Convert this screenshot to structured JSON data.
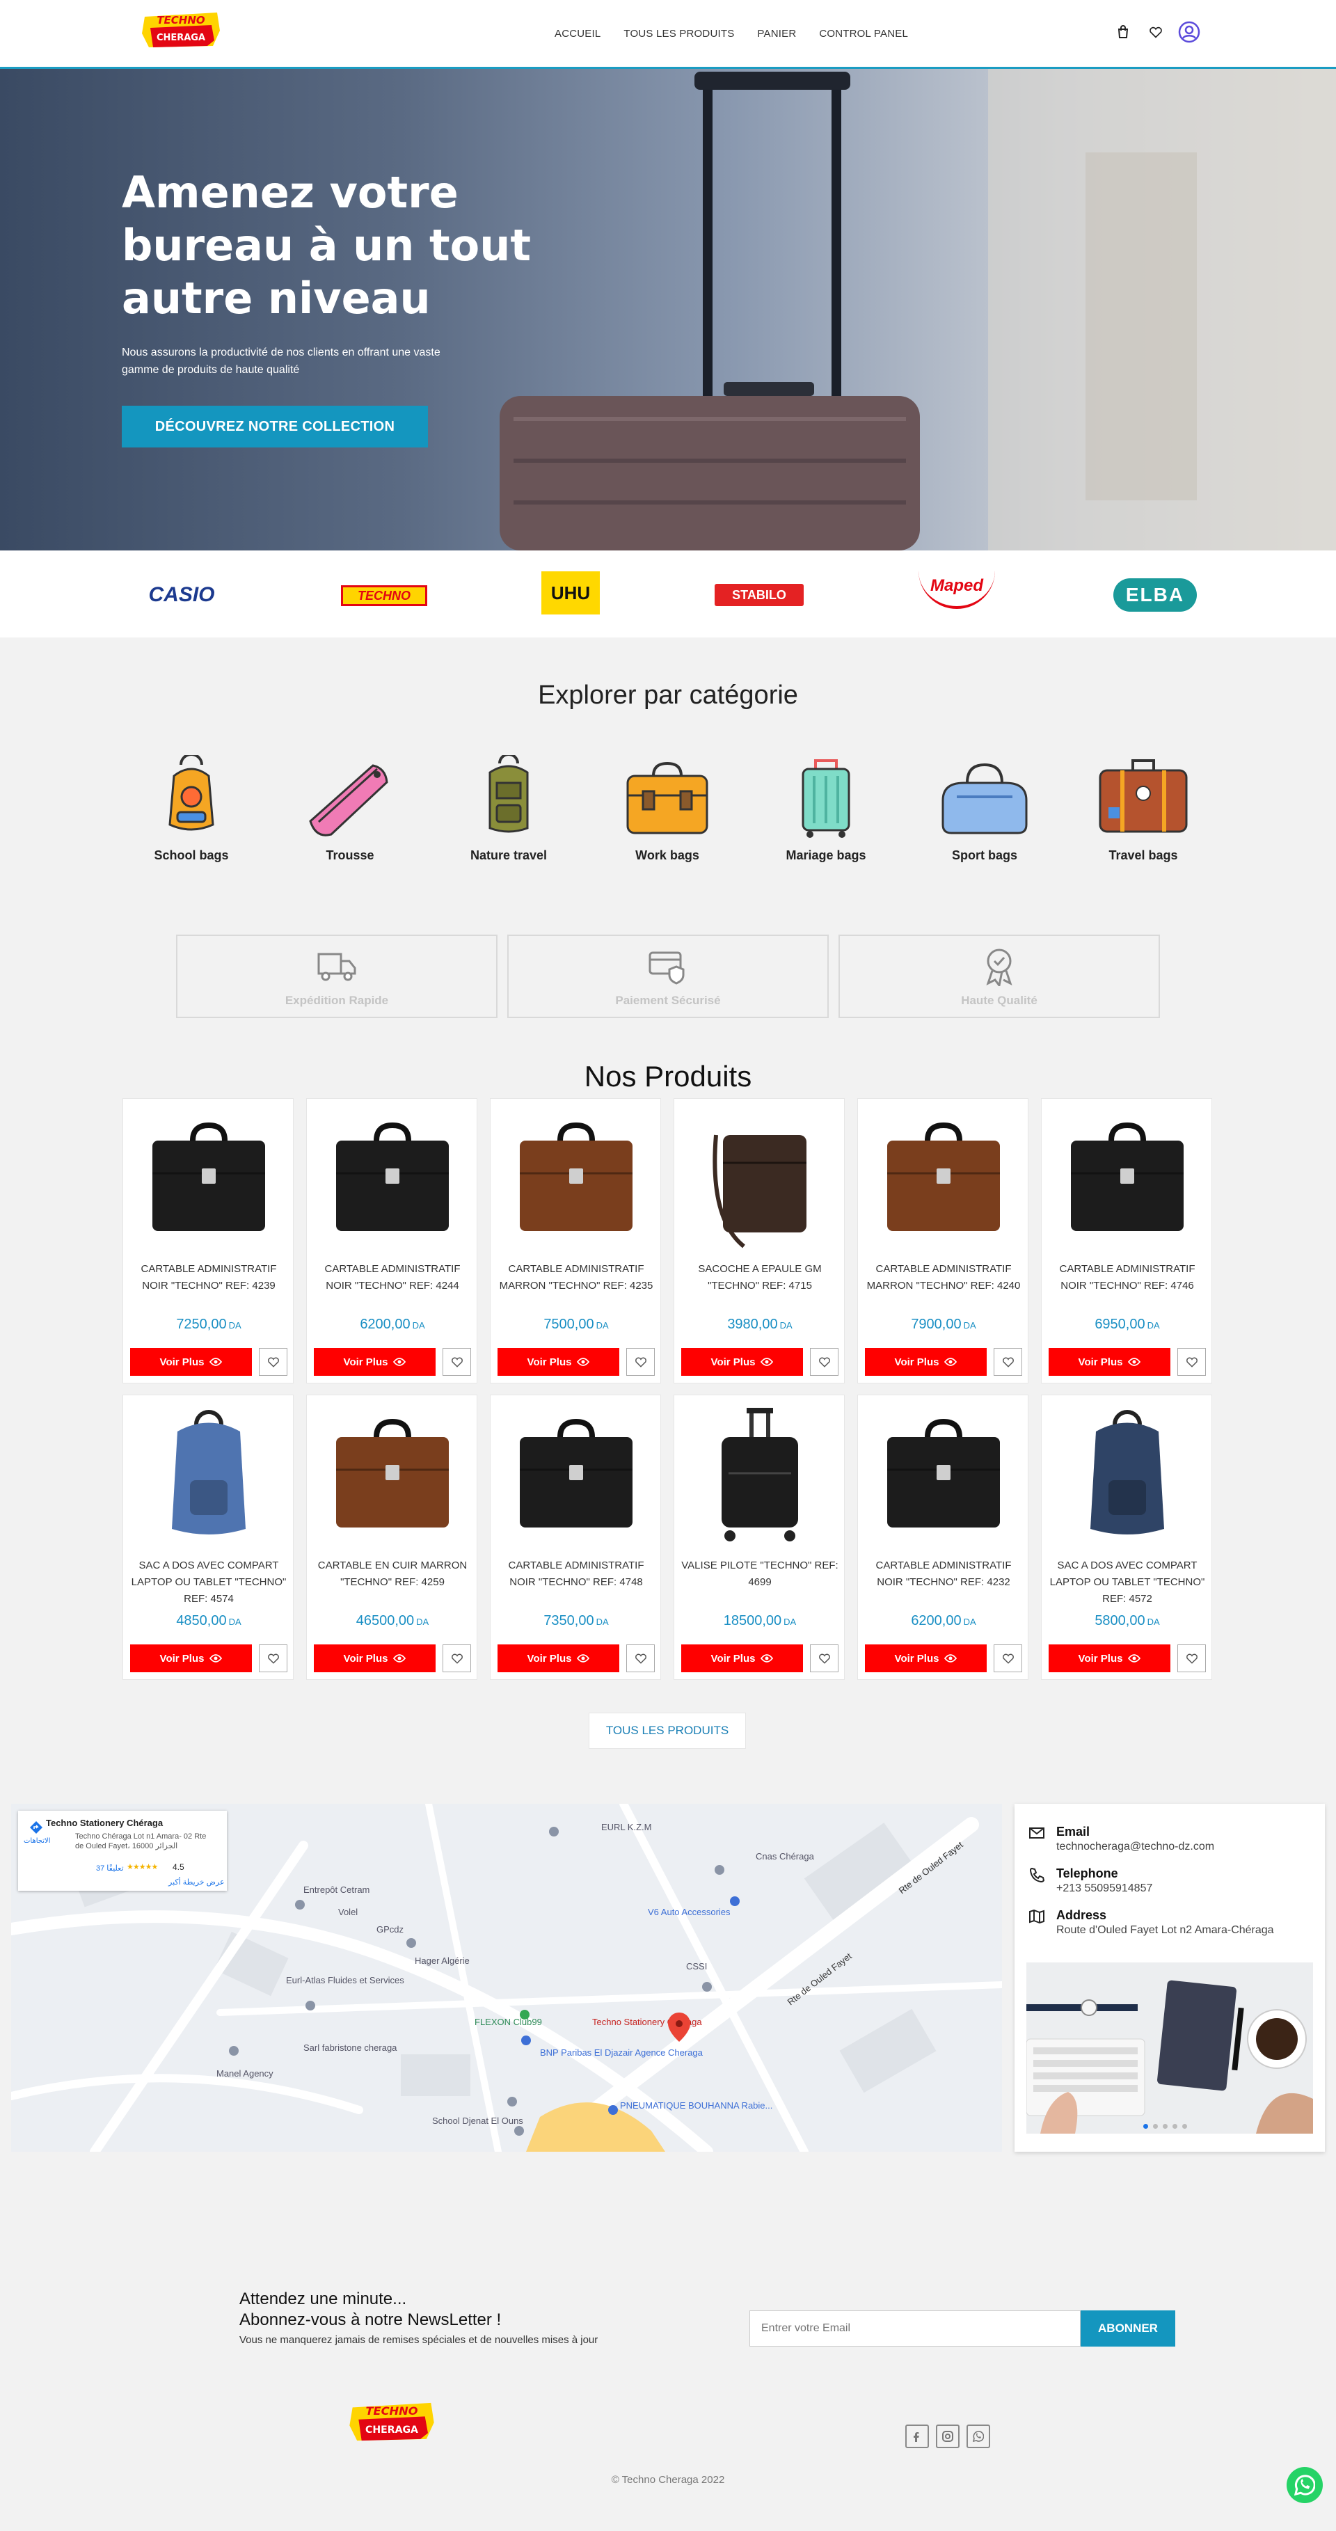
{
  "brand": {
    "logo_top": "TECHNO",
    "logo_bottom": "CHERAGA"
  },
  "nav": {
    "items": [
      "ACCUEIL",
      "TOUS LES PRODUITS",
      "PANIER",
      "CONTROL PANEL"
    ]
  },
  "hero": {
    "title": "Amenez votre bureau à un tout autre niveau",
    "subtitle": "Nous assurons la productivité de nos clients en offrant une vaste gamme de produits de haute qualité",
    "cta": "DÉCOUVREZ NOTRE COLLECTION"
  },
  "brands": [
    "CASIO",
    "TECHNO",
    "UHU",
    "STABILO",
    "Maped",
    "ELBA"
  ],
  "categories": {
    "title": "Explorer par catégorie",
    "items": [
      "School bags",
      "Trousse",
      "Nature travel",
      "Work bags",
      "Mariage bags",
      "Sport bags",
      "Travel bags"
    ]
  },
  "features": [
    "Expédition Rapide",
    "Paiement Sécurisé",
    "Haute Qualité"
  ],
  "products": {
    "title": "Nos Produits",
    "currency": "DA",
    "voir_label": "Voir Plus",
    "items": [
      {
        "name": "CARTABLE ADMINISTRATIF NOIR \"TECHNO\" REF: 4239",
        "price": "7250,00"
      },
      {
        "name": "CARTABLE ADMINISTRATIF NOIR \"TECHNO\" REF: 4244",
        "price": "6200,00"
      },
      {
        "name": "CARTABLE ADMINISTRATIF MARRON \"TECHNO\" REF: 4235",
        "price": "7500,00"
      },
      {
        "name": "SACOCHE A EPAULE GM \"TECHNO\" REF: 4715",
        "price": "3980,00"
      },
      {
        "name": "CARTABLE ADMINISTRATIF MARRON \"TECHNO\" REF: 4240",
        "price": "7900,00"
      },
      {
        "name": "CARTABLE ADMINISTRATIF NOIR \"TECHNO\" REF: 4746",
        "price": "6950,00"
      },
      {
        "name": "SAC A DOS AVEC COMPART LAPTOP OU TABLET \"TECHNO\" REF: 4574",
        "price": "4850,00"
      },
      {
        "name": "CARTABLE EN CUIR MARRON \"TECHNO\" REF: 4259",
        "price": "46500,00"
      },
      {
        "name": "CARTABLE ADMINISTRATIF NOIR \"TECHNO\" REF: 4748",
        "price": "7350,00"
      },
      {
        "name": "VALISE PILOTE \"TECHNO\" REF: 4699",
        "price": "18500,00"
      },
      {
        "name": "CARTABLE ADMINISTRATIF NOIR \"TECHNO\" REF: 4232",
        "price": "6200,00"
      },
      {
        "name": "SAC A DOS AVEC COMPART LAPTOP OU TABLET \"TECHNO\" REF: 4572",
        "price": "5800,00"
      }
    ],
    "all_button": "TOUS LES PRODUITS"
  },
  "map": {
    "place_name": "Techno Stationery Chéraga",
    "place_address": "Techno Chéraga Lot n1 Amara- 02 Rte de Ouled Fayet، 16000 الجزائر",
    "rating": "4.5",
    "reviews": "37 تعليقًا",
    "directions": "الاتجاهات",
    "larger_map": "عرض خريطة أكبر",
    "labels": [
      "EURL K.Z.M",
      "Cnas Chéraga",
      "Rte de Ouled Fayet",
      "Rte de Ouled Fayet",
      "V6 Auto Accessories",
      "Entrepôt Cetram",
      "Volel",
      "GPcdz",
      "Hager Algérie",
      "Eurl-Atlas Fluides et Services",
      "CSSI",
      "FLEXON Club99",
      "Techno Stationery Chéraga",
      "BNP Paribas El Djazair Agence Cheraga",
      "Sarl fabristone cheraga",
      "Manel Agency",
      "PNEUMATIQUE BOUHANNA Rabie...",
      "School Djenat El Ouns"
    ]
  },
  "contact": {
    "email_label": "Email",
    "email": "technocheraga@techno-dz.com",
    "phone_label": "Telephone",
    "phone": "+213 55095914857",
    "address_label": "Address",
    "address": "Route d'Ouled Fayet Lot n2 Amara-Chéraga"
  },
  "newsletter": {
    "line1": "Attendez une minute...",
    "line2": "Abonnez-vous à notre NewsLetter !",
    "line3": "Vous ne manquerez jamais de remises spéciales et de nouvelles mises à jour",
    "placeholder": "Entrer votre Email",
    "button": "ABONNER"
  },
  "footer": {
    "copyright": "© Techno Cheraga 2022"
  },
  "colors": {
    "accent": "#1496bf",
    "red": "#ff0000",
    "price": "#1a8fc4",
    "header_border": "#1b9cc2"
  }
}
